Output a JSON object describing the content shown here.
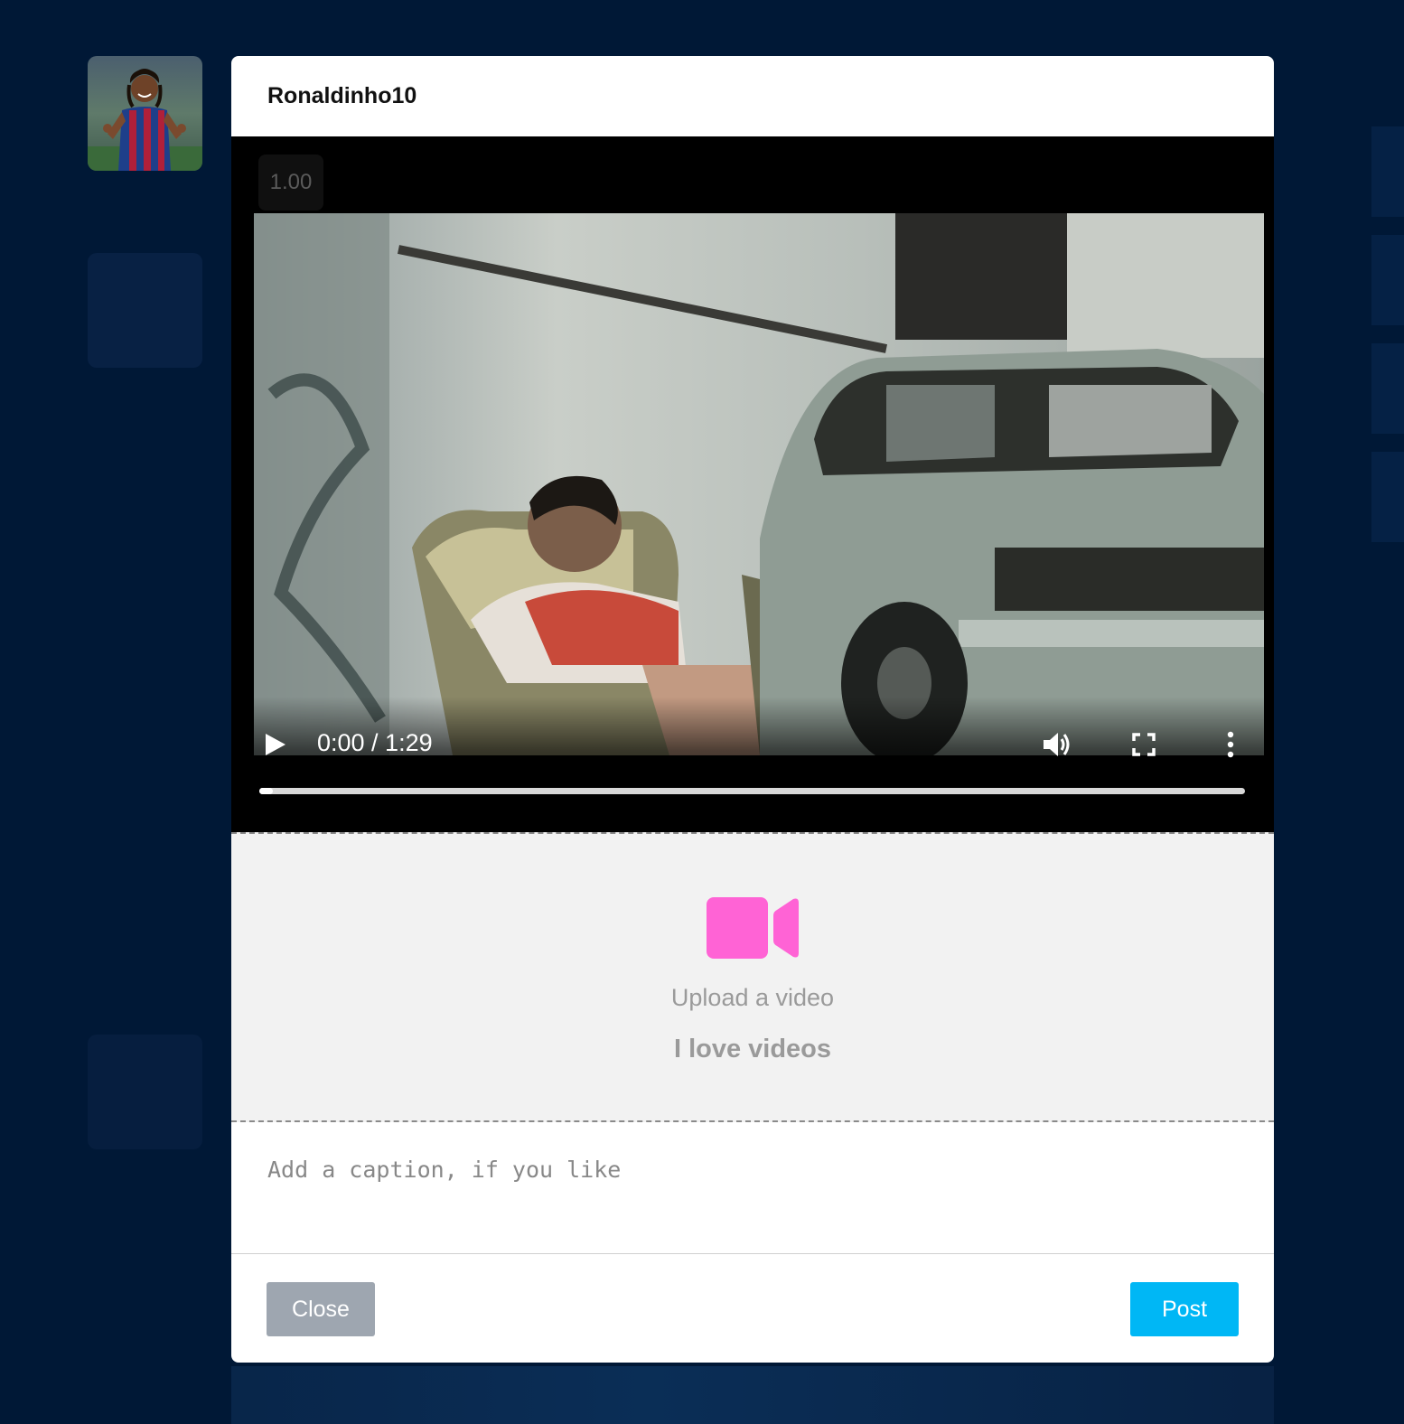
{
  "modal": {
    "username": "Ronaldinho10"
  },
  "video": {
    "playback_speed": "1.00",
    "time": "0:00 / 1:29",
    "progress": 0.013
  },
  "upload": {
    "title": "Upload a video",
    "subtitle": "I love videos",
    "icon": "video-camera-icon"
  },
  "caption": {
    "placeholder": "Add a caption, if you like",
    "value": ""
  },
  "buttons": {
    "close_label": "Close",
    "post_label": "Post"
  },
  "colors": {
    "page_background": "#001836",
    "upload_icon": "#ff63d5",
    "post_button": "#00b7f5",
    "close_button": "#9ea6b0"
  }
}
